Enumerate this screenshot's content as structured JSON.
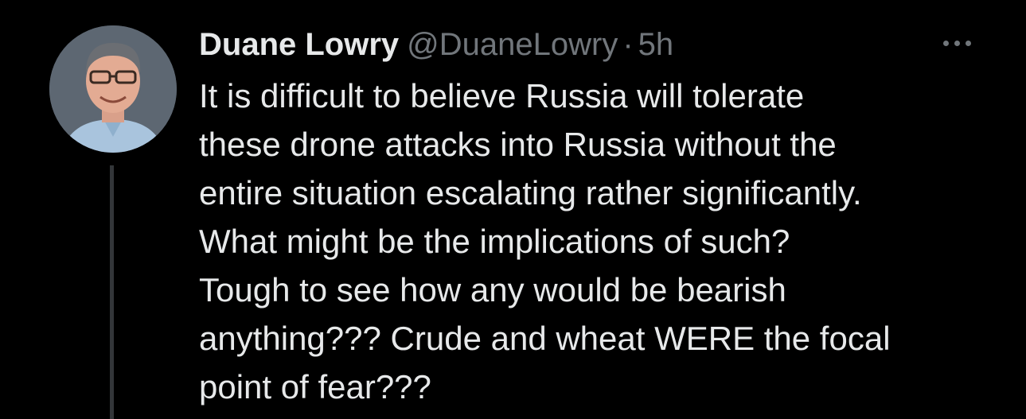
{
  "tweet": {
    "author": {
      "display_name": "Duane Lowry",
      "handle": "@DuaneLowry",
      "avatar_icon": "profile-photo"
    },
    "separator": "·",
    "timestamp": "5h",
    "text": "It is difficult to believe Russia will tolerate\nthese drone attacks into Russia without the\nentire situation escalating rather significantly.\nWhat might be the implications of such?\nTough to see how any would be bearish\nanything??? Crude and wheat WERE the focal\npoint of fear???",
    "more_icon": "more-options-icon"
  },
  "colors": {
    "background": "#000000",
    "primary_text": "#e7e9ea",
    "secondary_text": "#71767b",
    "thread_line": "#333639"
  }
}
